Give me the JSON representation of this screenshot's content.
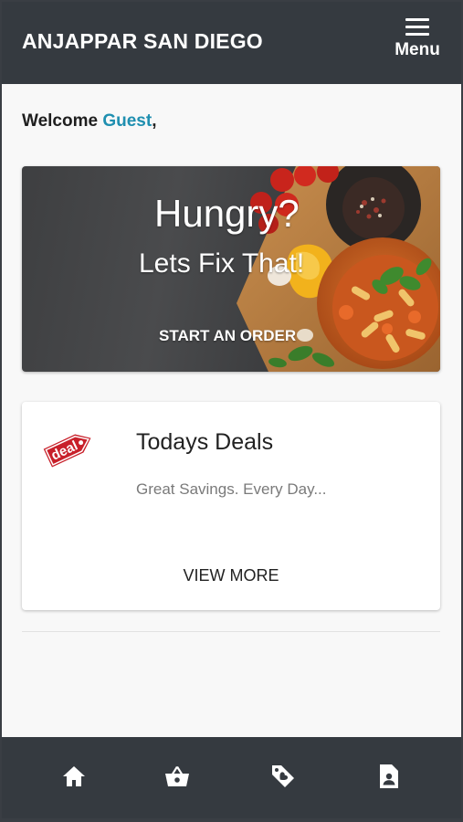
{
  "header": {
    "title": "ANJAPPAR SAN DIEGO",
    "menu_label": "Menu"
  },
  "welcome": {
    "prefix": "Welcome ",
    "name": "Guest",
    "suffix": ","
  },
  "hero": {
    "title": "Hungry?",
    "subtitle": "Lets Fix That!",
    "cta": "START AN ORDER"
  },
  "deals": {
    "icon": "deal-tag-icon",
    "badge_text": "deal",
    "title": "Todays Deals",
    "subtitle": "Great Savings. Every Day...",
    "cta": "VIEW MORE"
  },
  "bottom_nav": [
    {
      "icon": "home-icon"
    },
    {
      "icon": "basket-icon"
    },
    {
      "icon": "tag-heart-icon"
    },
    {
      "icon": "account-document-icon"
    }
  ],
  "colors": {
    "header_bg": "#353a40",
    "accent": "#1f8fb0",
    "page_bg": "#f8f8f8"
  }
}
